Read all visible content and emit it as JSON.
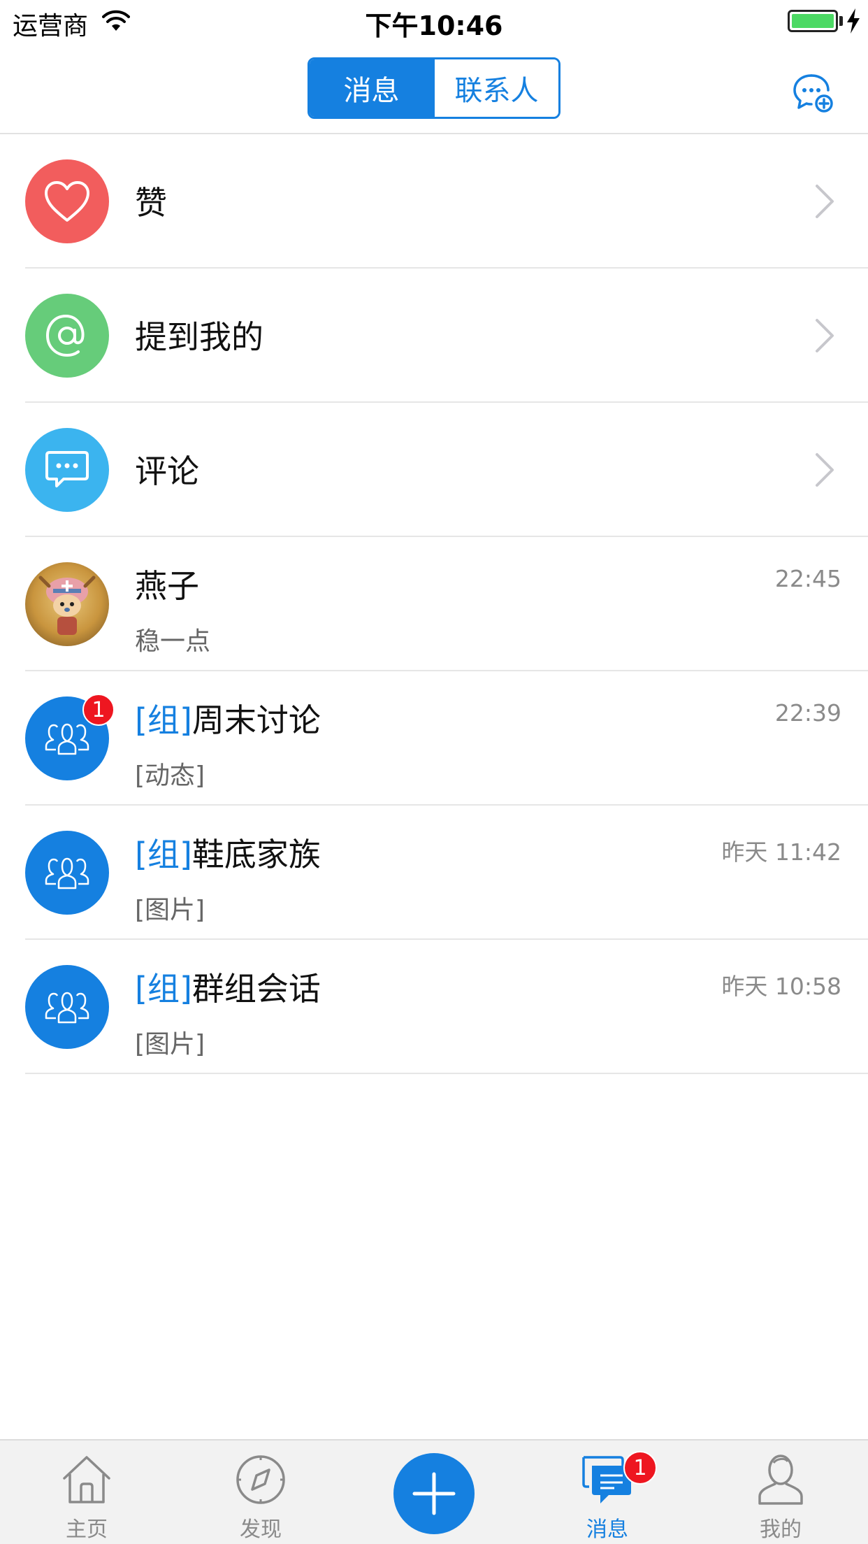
{
  "status_bar": {
    "carrier": "运营商",
    "time": "下午10:46",
    "battery_color": "#4cd964"
  },
  "nav": {
    "segments": [
      {
        "label": "消息",
        "active": true
      },
      {
        "label": "联系人",
        "active": false
      }
    ],
    "right_icon": "chat-add-icon"
  },
  "theme": {
    "accent": "#1580e0",
    "like_color": "#f25d5d",
    "mention_color": "#66cc7a",
    "comment_color": "#3bb4ef",
    "badge_color": "#ee1620"
  },
  "menu_rows": [
    {
      "label": "赞",
      "icon": "heart-icon"
    },
    {
      "label": "提到我的",
      "icon": "at-icon"
    },
    {
      "label": "评论",
      "icon": "comment-icon"
    }
  ],
  "conversations": [
    {
      "tag": "",
      "name": "燕子",
      "preview": "稳一点",
      "time": "22:45",
      "avatar": "user-avatar",
      "unread": ""
    },
    {
      "tag": "[组]",
      "name": "周末讨论",
      "preview": "[动态]",
      "time": "22:39",
      "avatar": "group-icon",
      "unread": "1"
    },
    {
      "tag": "[组]",
      "name": "鞋底家族",
      "preview": "[图片]",
      "time": "昨天 11:42",
      "avatar": "group-icon",
      "unread": ""
    },
    {
      "tag": "[组]",
      "name": "群组会话",
      "preview": "[图片]",
      "time": "昨天 10:58",
      "avatar": "group-icon",
      "unread": ""
    }
  ],
  "tab_bar": {
    "tabs": [
      {
        "label": "主页",
        "icon": "home-icon",
        "active": false
      },
      {
        "label": "发现",
        "icon": "compass-icon",
        "active": false
      },
      {
        "label": "",
        "icon": "plus-icon",
        "active": false
      },
      {
        "label": "消息",
        "icon": "message-icon",
        "active": true,
        "badge": "1"
      },
      {
        "label": "我的",
        "icon": "profile-icon",
        "active": false
      }
    ]
  }
}
